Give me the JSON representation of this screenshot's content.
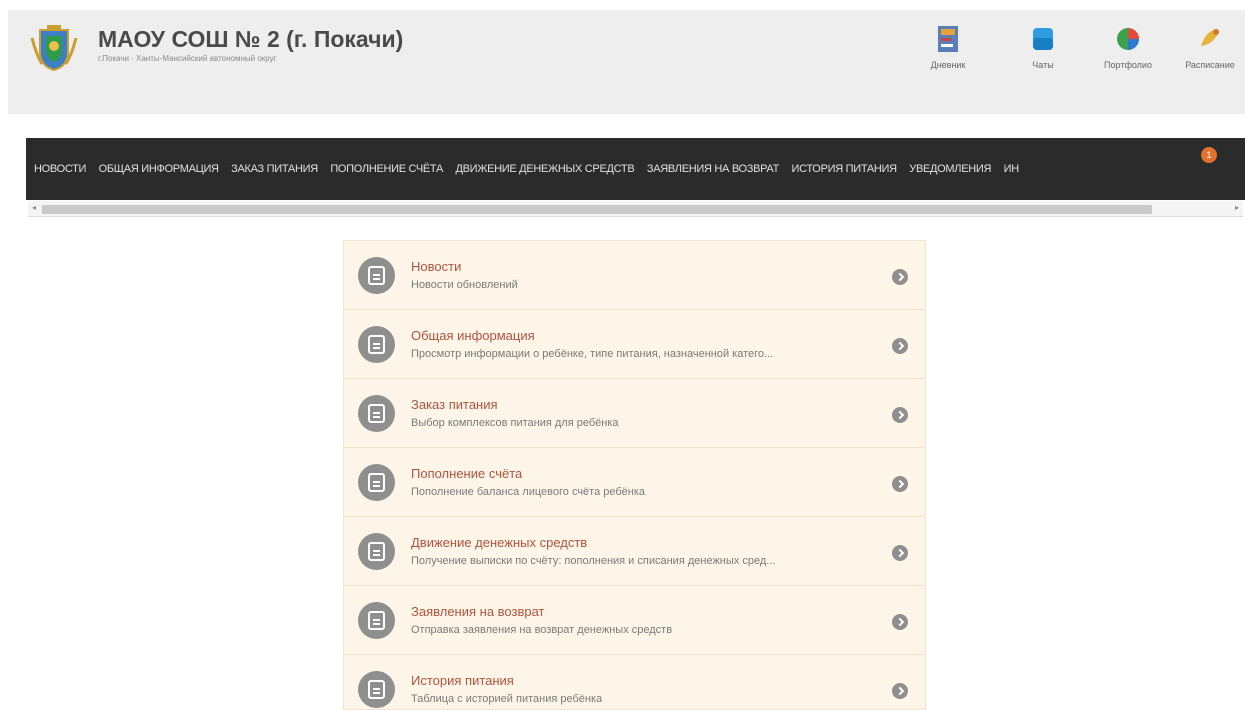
{
  "header": {
    "title": "МАОУ СОШ № 2 (г. Покачи)",
    "subtitle": "г.Покачи · Ханты-Мансийский автономный округ"
  },
  "quick_links": [
    {
      "label": "Дневник",
      "icon": "diary-icon"
    },
    {
      "label": "Чаты",
      "icon": "chat-icon"
    },
    {
      "label": "Портфолио",
      "icon": "portfolio-icon"
    },
    {
      "label": "Расписание",
      "icon": "schedule-icon"
    }
  ],
  "nav": {
    "items": [
      "НОВОСТИ",
      "ОБЩАЯ ИНФОРМАЦИЯ",
      "ЗАКАЗ ПИТАНИЯ",
      "ПОПОЛНЕНИЕ СЧЁТА",
      "ДВИЖЕНИЕ ДЕНЕЖНЫХ СРЕДСТВ",
      "ЗАЯВЛЕНИЯ НА ВОЗВРАТ",
      "ИСТОРИЯ ПИТАНИЯ",
      "УВЕДОМЛЕНИЯ",
      "ИН"
    ],
    "badge": "1"
  },
  "menu": {
    "rows": [
      {
        "title": "Новости",
        "desc": "Новости обновлений"
      },
      {
        "title": "Общая информация",
        "desc": "Просмотр информации о ребёнке, типе питания, назначенной катего..."
      },
      {
        "title": "Заказ питания",
        "desc": "Выбор комплексов питания для ребёнка"
      },
      {
        "title": "Пополнение счёта",
        "desc": "Пополнение баланса лицевого счёта ребёнка"
      },
      {
        "title": "Движение денежных средств",
        "desc": "Получение выписки по счёту: пополнения и списания денежных сред..."
      },
      {
        "title": "Заявления на возврат",
        "desc": "Отправка заявления на возврат денежных средств"
      },
      {
        "title": "История питания",
        "desc": "Таблица с историей питания ребёнка"
      }
    ]
  },
  "colors": {
    "navbar": "#2b2b2b",
    "menu_bg": "#fdf6e8",
    "row_title": "#b0533f",
    "badge": "#e0712f"
  }
}
